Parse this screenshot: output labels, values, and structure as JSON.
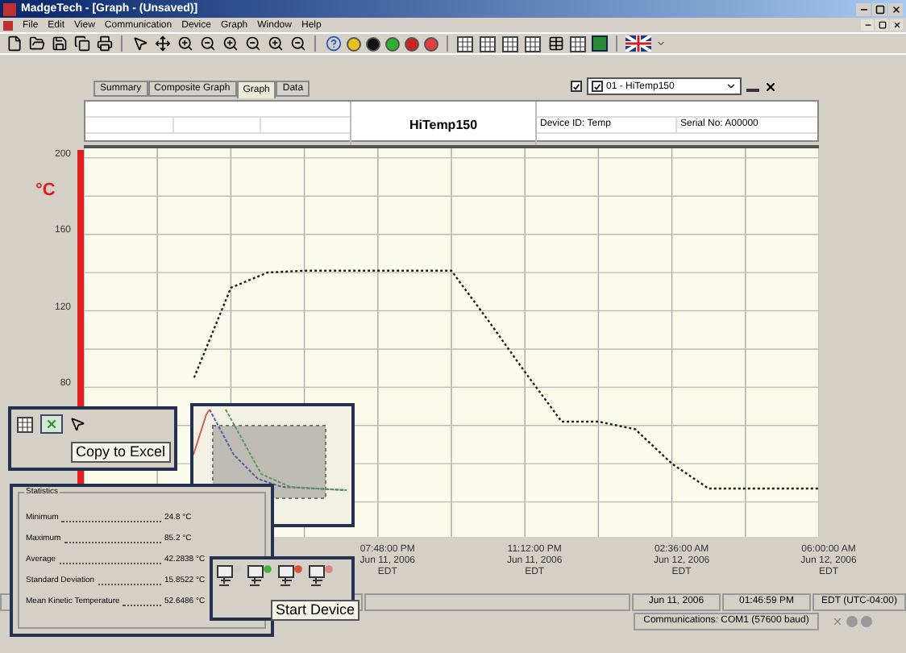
{
  "window": {
    "title": "MadgeTech - [Graph - (Unsaved)]"
  },
  "menu": [
    "File",
    "Edit",
    "View",
    "Communication",
    "Device",
    "Graph",
    "Window",
    "Help"
  ],
  "tabs": [
    {
      "label": "Summary",
      "selected": false
    },
    {
      "label": "Composite Graph",
      "selected": false
    },
    {
      "label": "Graph",
      "selected": true
    },
    {
      "label": "Data",
      "selected": false
    }
  ],
  "device_select": {
    "checked": true,
    "item_checked": true,
    "value": "01 - HiTemp150"
  },
  "header": {
    "title": "HiTemp150",
    "device_id": "Device ID: Temp",
    "serial": "Serial No: A00000"
  },
  "graph": {
    "unit": "°C",
    "chart_data": {
      "type": "line",
      "categories": [
        null,
        null,
        null,
        null,
        null,
        null,
        null,
        null,
        "07:48:00 PM\nJun 11, 2006\nEDT",
        null,
        null,
        null,
        "11:12:00 PM\nJun 11, 2006\nEDT",
        null,
        null,
        null,
        "02:36:00 AM\nJun 12, 2006\nEDT",
        null,
        null,
        null,
        "06:00:00 AM\nJun 12, 2006\nEDT"
      ],
      "series": [
        {
          "color": "#2a1a1a",
          "line_style": "dotted",
          "values": [
            null,
            null,
            null,
            85,
            132,
            140,
            141,
            141,
            141,
            141,
            141,
            115,
            88,
            62,
            62,
            58,
            40,
            27,
            27,
            27,
            27
          ]
        }
      ],
      "ylim": [
        0,
        205
      ],
      "yticks": [
        80,
        120,
        160,
        200
      ],
      "grid": true
    }
  },
  "status_bar": {
    "date": "Jun 11, 2006",
    "time": "01:46:59 PM",
    "zone": "EDT (UTC-04:00)",
    "communications": "Communications: COM1 (57600 baud)"
  },
  "excel_callout": {
    "tooltip": "Copy to Excel"
  },
  "statistics": {
    "title": "Statistics",
    "rows": [
      {
        "label": "Minimum",
        "value": "24.8 °C"
      },
      {
        "label": "Maximum",
        "value": "85.2 °C"
      },
      {
        "label": "Average",
        "value": "42.2838 °C"
      },
      {
        "label": "Standard Deviation",
        "value": "15.8522 °C"
      },
      {
        "label": "Mean Kinetic Temperature",
        "value": "52.6486 °C"
      }
    ]
  },
  "device_callout": {
    "tooltip": "Start Device"
  }
}
